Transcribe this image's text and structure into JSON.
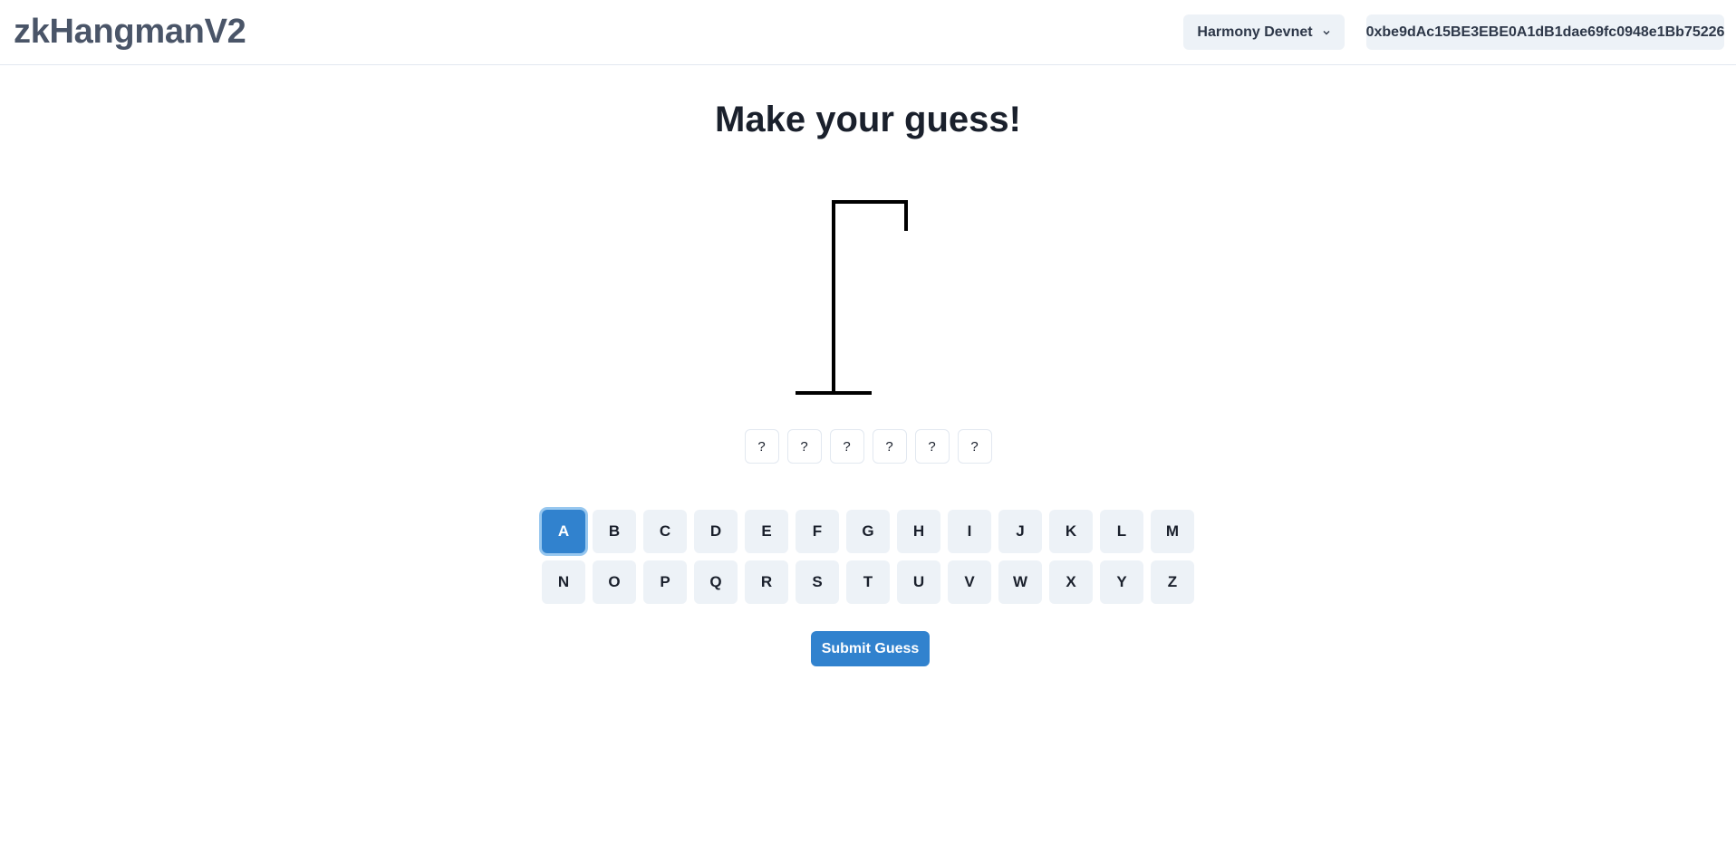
{
  "header": {
    "app_title": "zkHangmanV2",
    "network": "Harmony Devnet",
    "account": "0xbe9dAc15BE3EBE0A1dB1dae69fc0948e1Bb75226"
  },
  "main": {
    "title": "Make your guess!",
    "word_slots": [
      "?",
      "?",
      "?",
      "?",
      "?",
      "?"
    ],
    "keyboard": {
      "row1": [
        "A",
        "B",
        "C",
        "D",
        "E",
        "F",
        "G",
        "H",
        "I",
        "J",
        "K",
        "L",
        "M"
      ],
      "row2": [
        "N",
        "O",
        "P",
        "Q",
        "R",
        "S",
        "T",
        "U",
        "V",
        "W",
        "X",
        "Y",
        "Z"
      ],
      "selected": "A"
    },
    "submit_label": "Submit Guess"
  },
  "colors": {
    "accent": "#3182ce",
    "key_bg": "#edf2f7",
    "title_gray": "#4a5568"
  }
}
